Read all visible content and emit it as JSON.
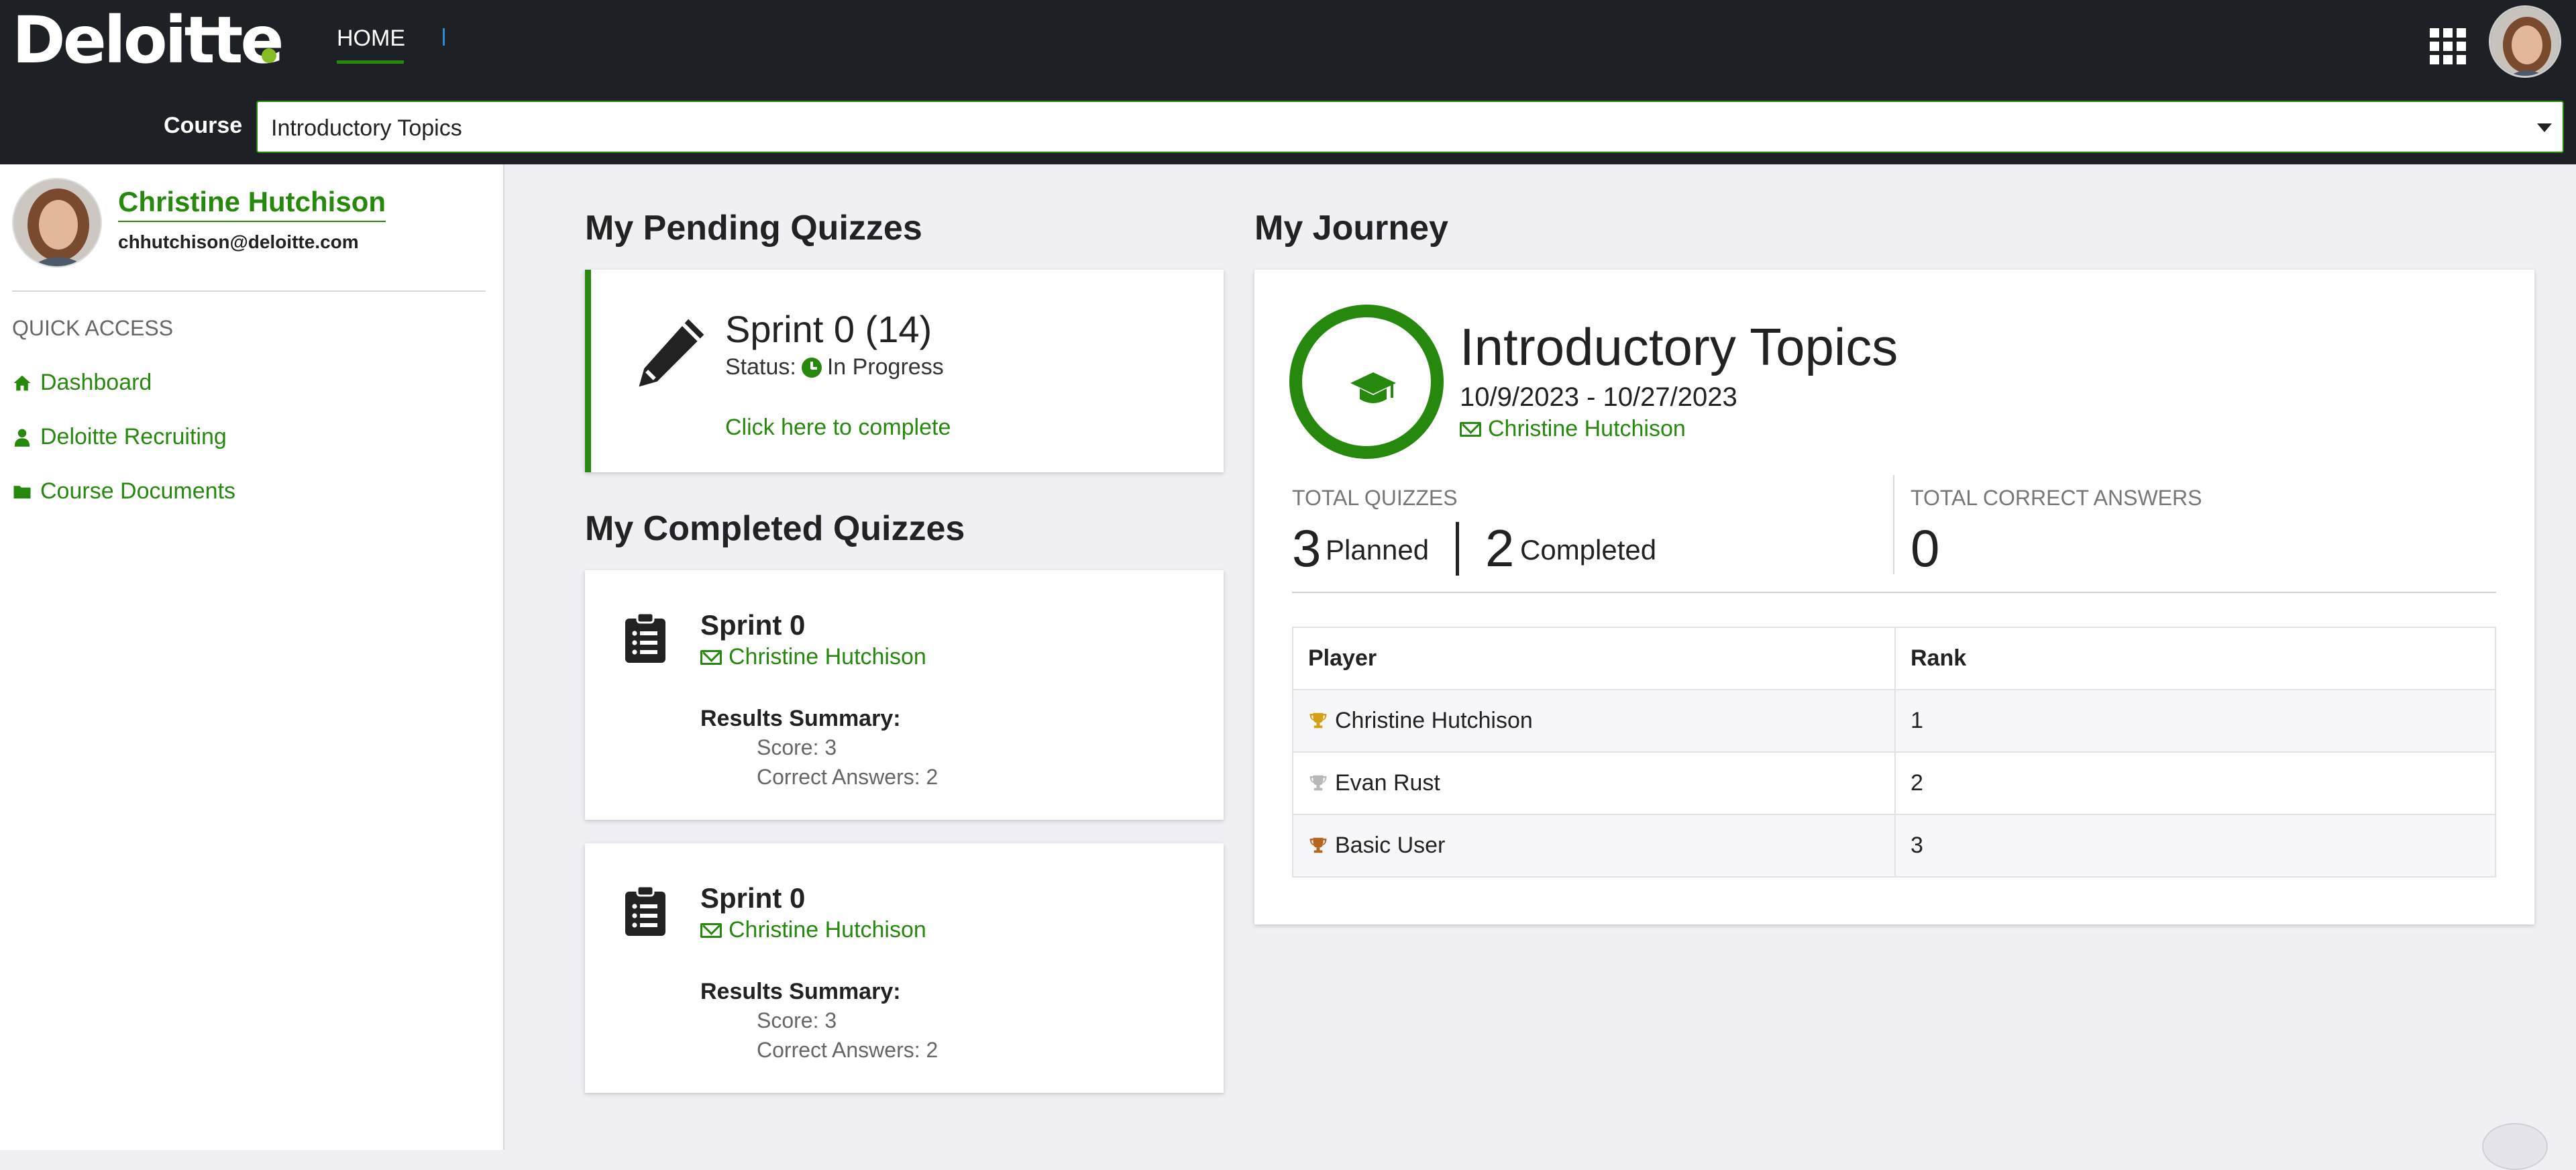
{
  "header": {
    "logo": "Deloitte",
    "nav": {
      "home_label": "HOME"
    },
    "course_label": "Course",
    "course_value": "Introductory Topics"
  },
  "sidebar": {
    "user_name": "Christine Hutchison",
    "user_email": "chhutchison@deloitte.com",
    "quick_access_label": "QUICK ACCESS",
    "links": [
      {
        "label": "Dashboard",
        "icon": "home-icon"
      },
      {
        "label": "Deloitte Recruiting",
        "icon": "user-tie-icon"
      },
      {
        "label": "Course Documents",
        "icon": "folder-icon"
      }
    ]
  },
  "pending": {
    "heading": "My Pending Quizzes",
    "quiz": {
      "title": "Sprint 0 (14)",
      "status_label": "Status:",
      "status_value": "In Progress",
      "link_label": "Click here to complete"
    }
  },
  "completed": {
    "heading": "My Completed Quizzes",
    "quizzes": [
      {
        "title": "Sprint 0",
        "user": "Christine Hutchison",
        "summary_label": "Results Summary:",
        "score": "Score: 3",
        "correct": "Correct Answers: 2"
      },
      {
        "title": "Sprint 0",
        "user": "Christine Hutchison",
        "summary_label": "Results Summary:",
        "score": "Score: 3",
        "correct": "Correct Answers: 2"
      }
    ]
  },
  "journey": {
    "heading": "My Journey",
    "course_title": "Introductory Topics",
    "dates": "10/9/2023 - 10/27/2023",
    "user": "Christine Hutchison",
    "total_quizzes_label": "TOTAL QUIZZES",
    "planned_count": "3",
    "planned_label": "Planned",
    "completed_count": "2",
    "completed_label": "Completed",
    "total_correct_label": "TOTAL CORRECT ANSWERS",
    "total_correct_value": "0",
    "leaderboard": {
      "headers": [
        "Player",
        "Rank"
      ],
      "rows": [
        {
          "player": "Christine Hutchison",
          "rank": "1",
          "trophy_color": "#d4a017"
        },
        {
          "player": "Evan Rust",
          "rank": "2",
          "trophy_color": "#b8b8b8"
        },
        {
          "player": "Basic User",
          "rank": "3",
          "trophy_color": "#b5651d"
        }
      ]
    }
  },
  "colors": {
    "accent": "#26890d",
    "topbar": "#1d2024",
    "brand_dot": "#86bc25"
  }
}
